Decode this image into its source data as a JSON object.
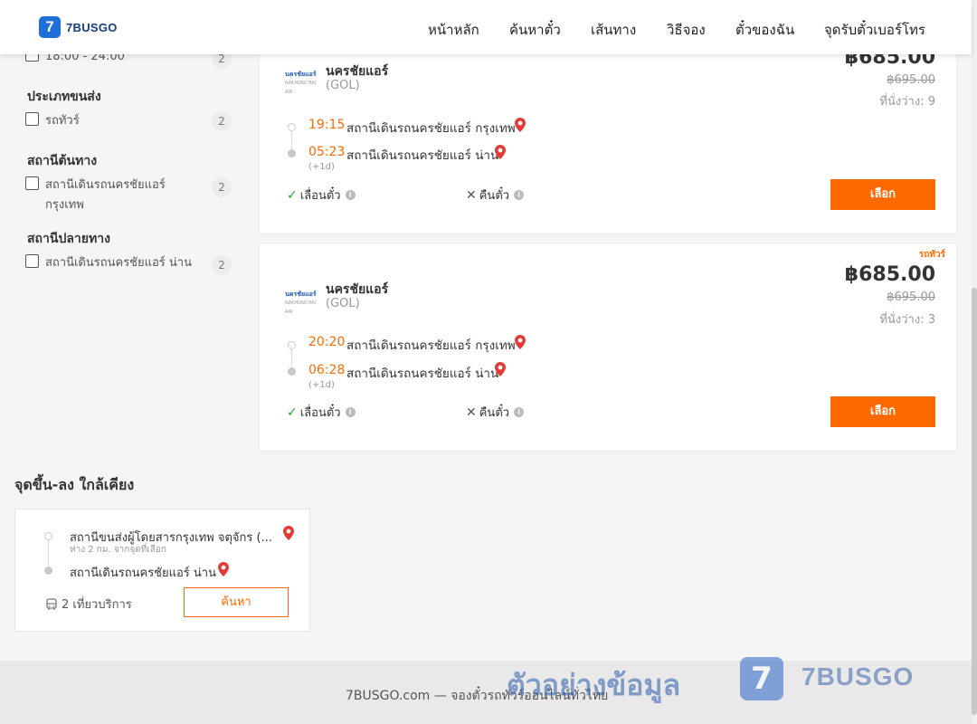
{
  "header": {
    "logo_text": "7BUSGO",
    "logo_glyph": "7",
    "nav": [
      "หน้าหลัก",
      "ค้นหาตั๋ว",
      "เส้นทาง",
      "วิธีจอง",
      "ตั๋วของฉัน",
      "จุดรับตั๋วเบอร์โทร"
    ]
  },
  "sidebar": {
    "time_filter": {
      "label": "18:00 - 24:00",
      "count": "2"
    },
    "transport_type": {
      "title": "ประเภทขนส่ง",
      "items": [
        {
          "label": "รถทัวร์",
          "count": "2"
        }
      ]
    },
    "origin": {
      "title": "สถานีต้นทาง",
      "items": [
        {
          "label": "สถานีเดินรถนครชัยแอร์ กรุงเทพ",
          "count": "2"
        }
      ]
    },
    "destination": {
      "title": "สถานีปลายทาง",
      "items": [
        {
          "label": "สถานีเดินรถนครชัยแอร์ น่าน",
          "count": "2"
        }
      ]
    }
  },
  "trips": [
    {
      "operator": "นครชัยแอร์",
      "code": "(GOL)",
      "price": "฿685.00",
      "old_price": "฿695.00",
      "seats": "ที่นั่งว่าง: 9",
      "bus_tag": "",
      "depart_time": "19:15",
      "depart_station": "สถานีเดินรถนครชัยแอร์ กรุงเทพ",
      "arrive_time": "05:23",
      "arrive_station": "สถานีเดินรถนครชัยแอร์ น่าน",
      "next_day": "(+1d)",
      "change_ticket": "เลื่อนตั๋ว",
      "refund": "คืนตั๋ว",
      "select_label": "เลือก"
    },
    {
      "operator": "นครชัยแอร์",
      "code": "(GOL)",
      "price": "฿685.00",
      "old_price": "฿695.00",
      "seats": "ที่นั่งว่าง: 3",
      "bus_tag": "รถทัวร์",
      "depart_time": "20:20",
      "depart_station": "สถานีเดินรถนครชัยแอร์ กรุงเทพ",
      "arrive_time": "06:28",
      "arrive_station": "สถานีเดินรถนครชัยแอร์ น่าน",
      "next_day": "(+1d)",
      "change_ticket": "เลื่อนตั๋ว",
      "refund": "คืนตั๋ว",
      "select_label": "เลือก"
    }
  ],
  "nearby": {
    "title": "จุดขึ้น-ลง ใกล้เคียง",
    "from_station": "สถานีขนส่งผู้โดยสารกรุงเทพ จตุจักร (...",
    "from_distance": "ห่าง 2 กม. จากจุดที่เลือก",
    "to_station": "สถานีเดินรถนครชัยแอร์ น่าน",
    "services": "2 เที่ยวบริการ",
    "search_label": "ค้นหา"
  },
  "footer": {
    "text": "7BUSGO.com — จองตั๋วรถทัวร์ออนไลน์ทั่วไทย",
    "watermark": "ตัวอย่างข้อมูล",
    "watermark_logo": "7BUSGO",
    "watermark_glyph": "7"
  },
  "colors": {
    "accent": "#ff6a00",
    "brand": "#1e6fd9",
    "pin": "#e53935",
    "check": "#2e9c3a"
  }
}
